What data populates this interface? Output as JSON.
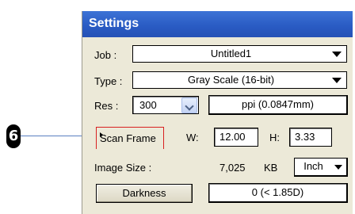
{
  "callout": {
    "number": "6"
  },
  "panel": {
    "title": "Settings",
    "job": {
      "label": "Job :",
      "value": "Untitled1"
    },
    "type": {
      "label": "Type :",
      "value": "Gray Scale (16-bit)"
    },
    "res": {
      "label": "Res :",
      "value": "300",
      "unit_value": "ppi (0.0847mm)"
    },
    "scan_frame": {
      "label": "Scan Frame",
      "w_label": "W:",
      "w_value": "12.00",
      "h_label": "H:",
      "h_value": "3.33"
    },
    "image_size": {
      "label": "Image Size :",
      "value": "7,025",
      "unit": "KB",
      "dim_unit": "Inch"
    },
    "darkness": {
      "button_label": "Darkness",
      "value": "0 (< 1.85D)"
    }
  },
  "colors": {
    "title_bar": "#2a5cc4",
    "panel_bg": "#ece9d8",
    "callout_line": "#5a7fc0",
    "highlight": "#d82020"
  }
}
